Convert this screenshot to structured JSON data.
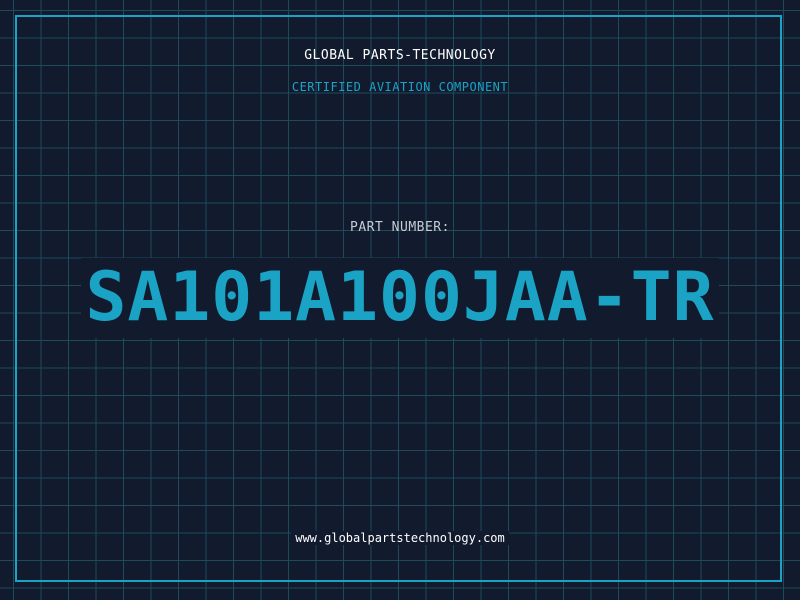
{
  "header": {
    "title": "GLOBAL PARTS-TECHNOLOGY",
    "subtitle": "CERTIFIED AVIATION COMPONENT"
  },
  "part": {
    "label": "PART NUMBER:",
    "number": "SA101A100JAA-TR"
  },
  "footer": {
    "website": "www.globalpartstechnology.com"
  },
  "colors": {
    "background": "#121a2e",
    "grid": "#1f4a5c",
    "accent": "#1ba3c6",
    "text": "#ffffff",
    "label": "#c6ccd6"
  }
}
